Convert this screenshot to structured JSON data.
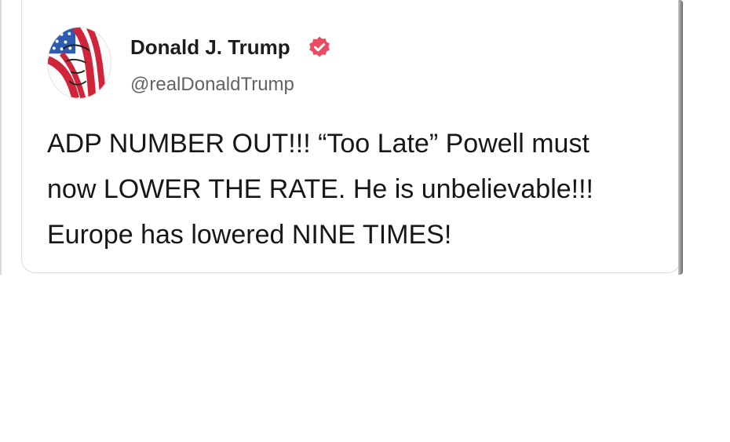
{
  "post": {
    "author_name": "Donald J. Trump",
    "author_handle": "@realDonaldTrump",
    "verified": true,
    "text": "ADP NUMBER OUT!!! “Too Late” Powell must\nnow LOWER THE RATE. He is unbelievable!!!\nEurope has lowered NINE TIMES!"
  },
  "colors": {
    "badge": "#ec4c62",
    "avatar_red": "#d0243a",
    "avatar_blue": "#2d5bb2"
  },
  "icons": {
    "avatar": "flag-portrait-avatar",
    "verified": "verified-badge-icon"
  }
}
